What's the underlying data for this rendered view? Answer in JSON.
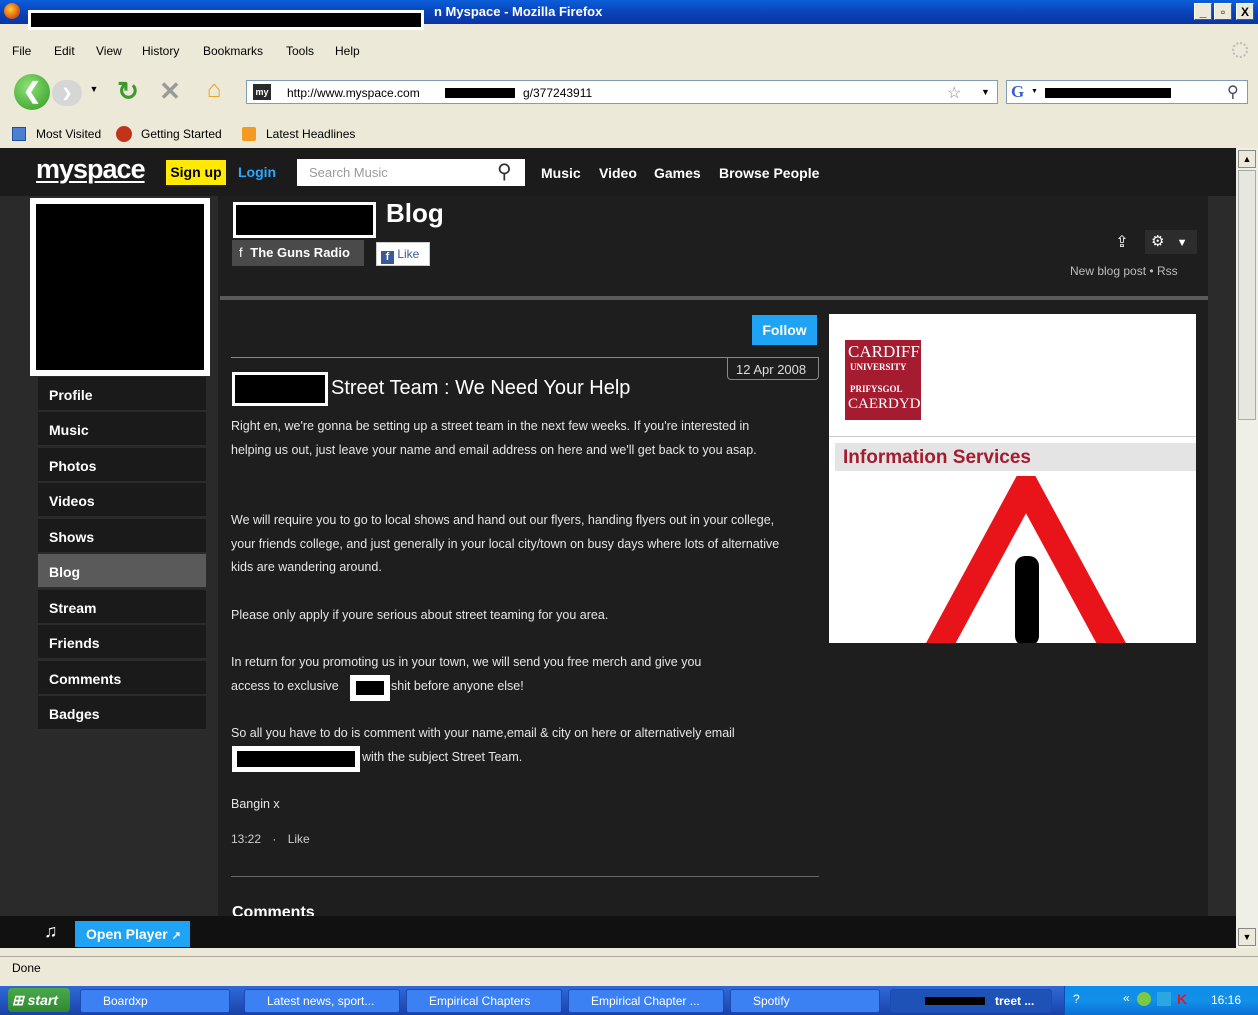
{
  "window": {
    "title": "n Myspace - Mozilla Firefox",
    "min": "_",
    "max": "▫",
    "close": "X"
  },
  "menu": [
    "File",
    "Edit",
    "View",
    "History",
    "Bookmarks",
    "Tools",
    "Help"
  ],
  "nav": {
    "url_prefix": "http://www.myspace.com",
    "url_suffix": "g/377243911",
    "site_icon_text": "my",
    "search_engine": "G"
  },
  "bookmarks": [
    "Most Visited",
    "Getting Started",
    "Latest Headlines"
  ],
  "myspace": {
    "logo": "myspace",
    "signup": "Sign up",
    "login": "Login",
    "search_placeholder": "Search Music",
    "topnav": [
      "Music",
      "Video",
      "Games",
      "Browse People"
    ]
  },
  "page": {
    "blog_title": "Blog",
    "fb_page": "The Guns Radio",
    "fb_like": "Like",
    "new_blog_post": "New blog post",
    "rss": "Rss",
    "sep": "•",
    "follow": "Follow"
  },
  "sidebar": [
    "Profile",
    "Music",
    "Photos",
    "Videos",
    "Shows",
    "Blog",
    "Stream",
    "Friends",
    "Comments",
    "Badges"
  ],
  "post": {
    "date": "12 Apr 2008",
    "title": "Street Team : We Need Your Help",
    "p1": "Right en, we're gonna be setting up a street team in the next few weeks. If you're interested in helping us out, just leave your name and email address on here and we'll get back to you asap.",
    "p2": "We will require you to go to local shows and hand out our flyers, handing flyers out in your college, your friends college, and just generally in your local city/town on busy days where lots of alternative kids are wandering around.",
    "p3": "Please only apply if youre serious about street teaming for you area.",
    "p4a": "In return for you promoting us in your town, we will send you free merch and give you",
    "p4b_pre": "access to exclusive",
    "p4b_post": "shit before anyone else!",
    "p5a": "So all you have to do is comment with your name,email & city on here or alternatively email",
    "p5b": "with the subject Street Team.",
    "sign": "Bangin x",
    "time": "13:22",
    "dot": "·",
    "like": "Like",
    "comments_heading": "Comments"
  },
  "ad": {
    "logo_line1": "CARDIFF",
    "logo_line2": "UNIVERSITY",
    "logo_line3": "PRIFYSGOL",
    "logo_line4": "CAERDYDD",
    "heading": "Information Services"
  },
  "player": {
    "open_player": "Open Player"
  },
  "status": "Done",
  "taskbar": {
    "start": "start",
    "tasks": [
      "Boardxp",
      "Latest news, sport...",
      "Empirical Chapters",
      "Empirical Chapter ...",
      "Spotify",
      "treet ..."
    ],
    "clock": "16:16"
  }
}
